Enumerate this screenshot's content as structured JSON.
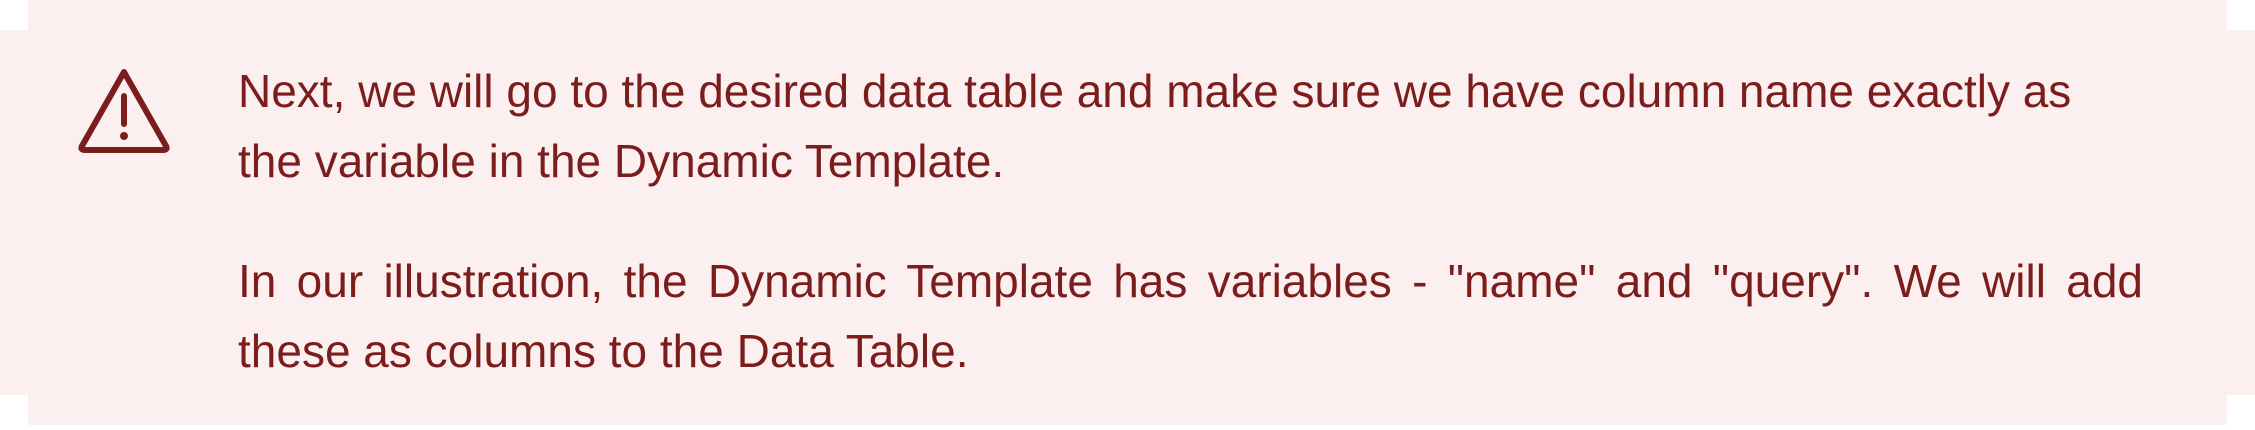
{
  "callout": {
    "icon": "warning-triangle-icon",
    "accent_color": "#7c1d1d",
    "background_color": "#fbefef",
    "paragraphs": [
      "Next, we will go to the desired data table and make sure we have column name exactly as the variable in the Dynamic Template.",
      "In our illustration, the Dynamic Template has variables - \"name\" and \"query\". We will add these as columns to the Data Table."
    ]
  }
}
